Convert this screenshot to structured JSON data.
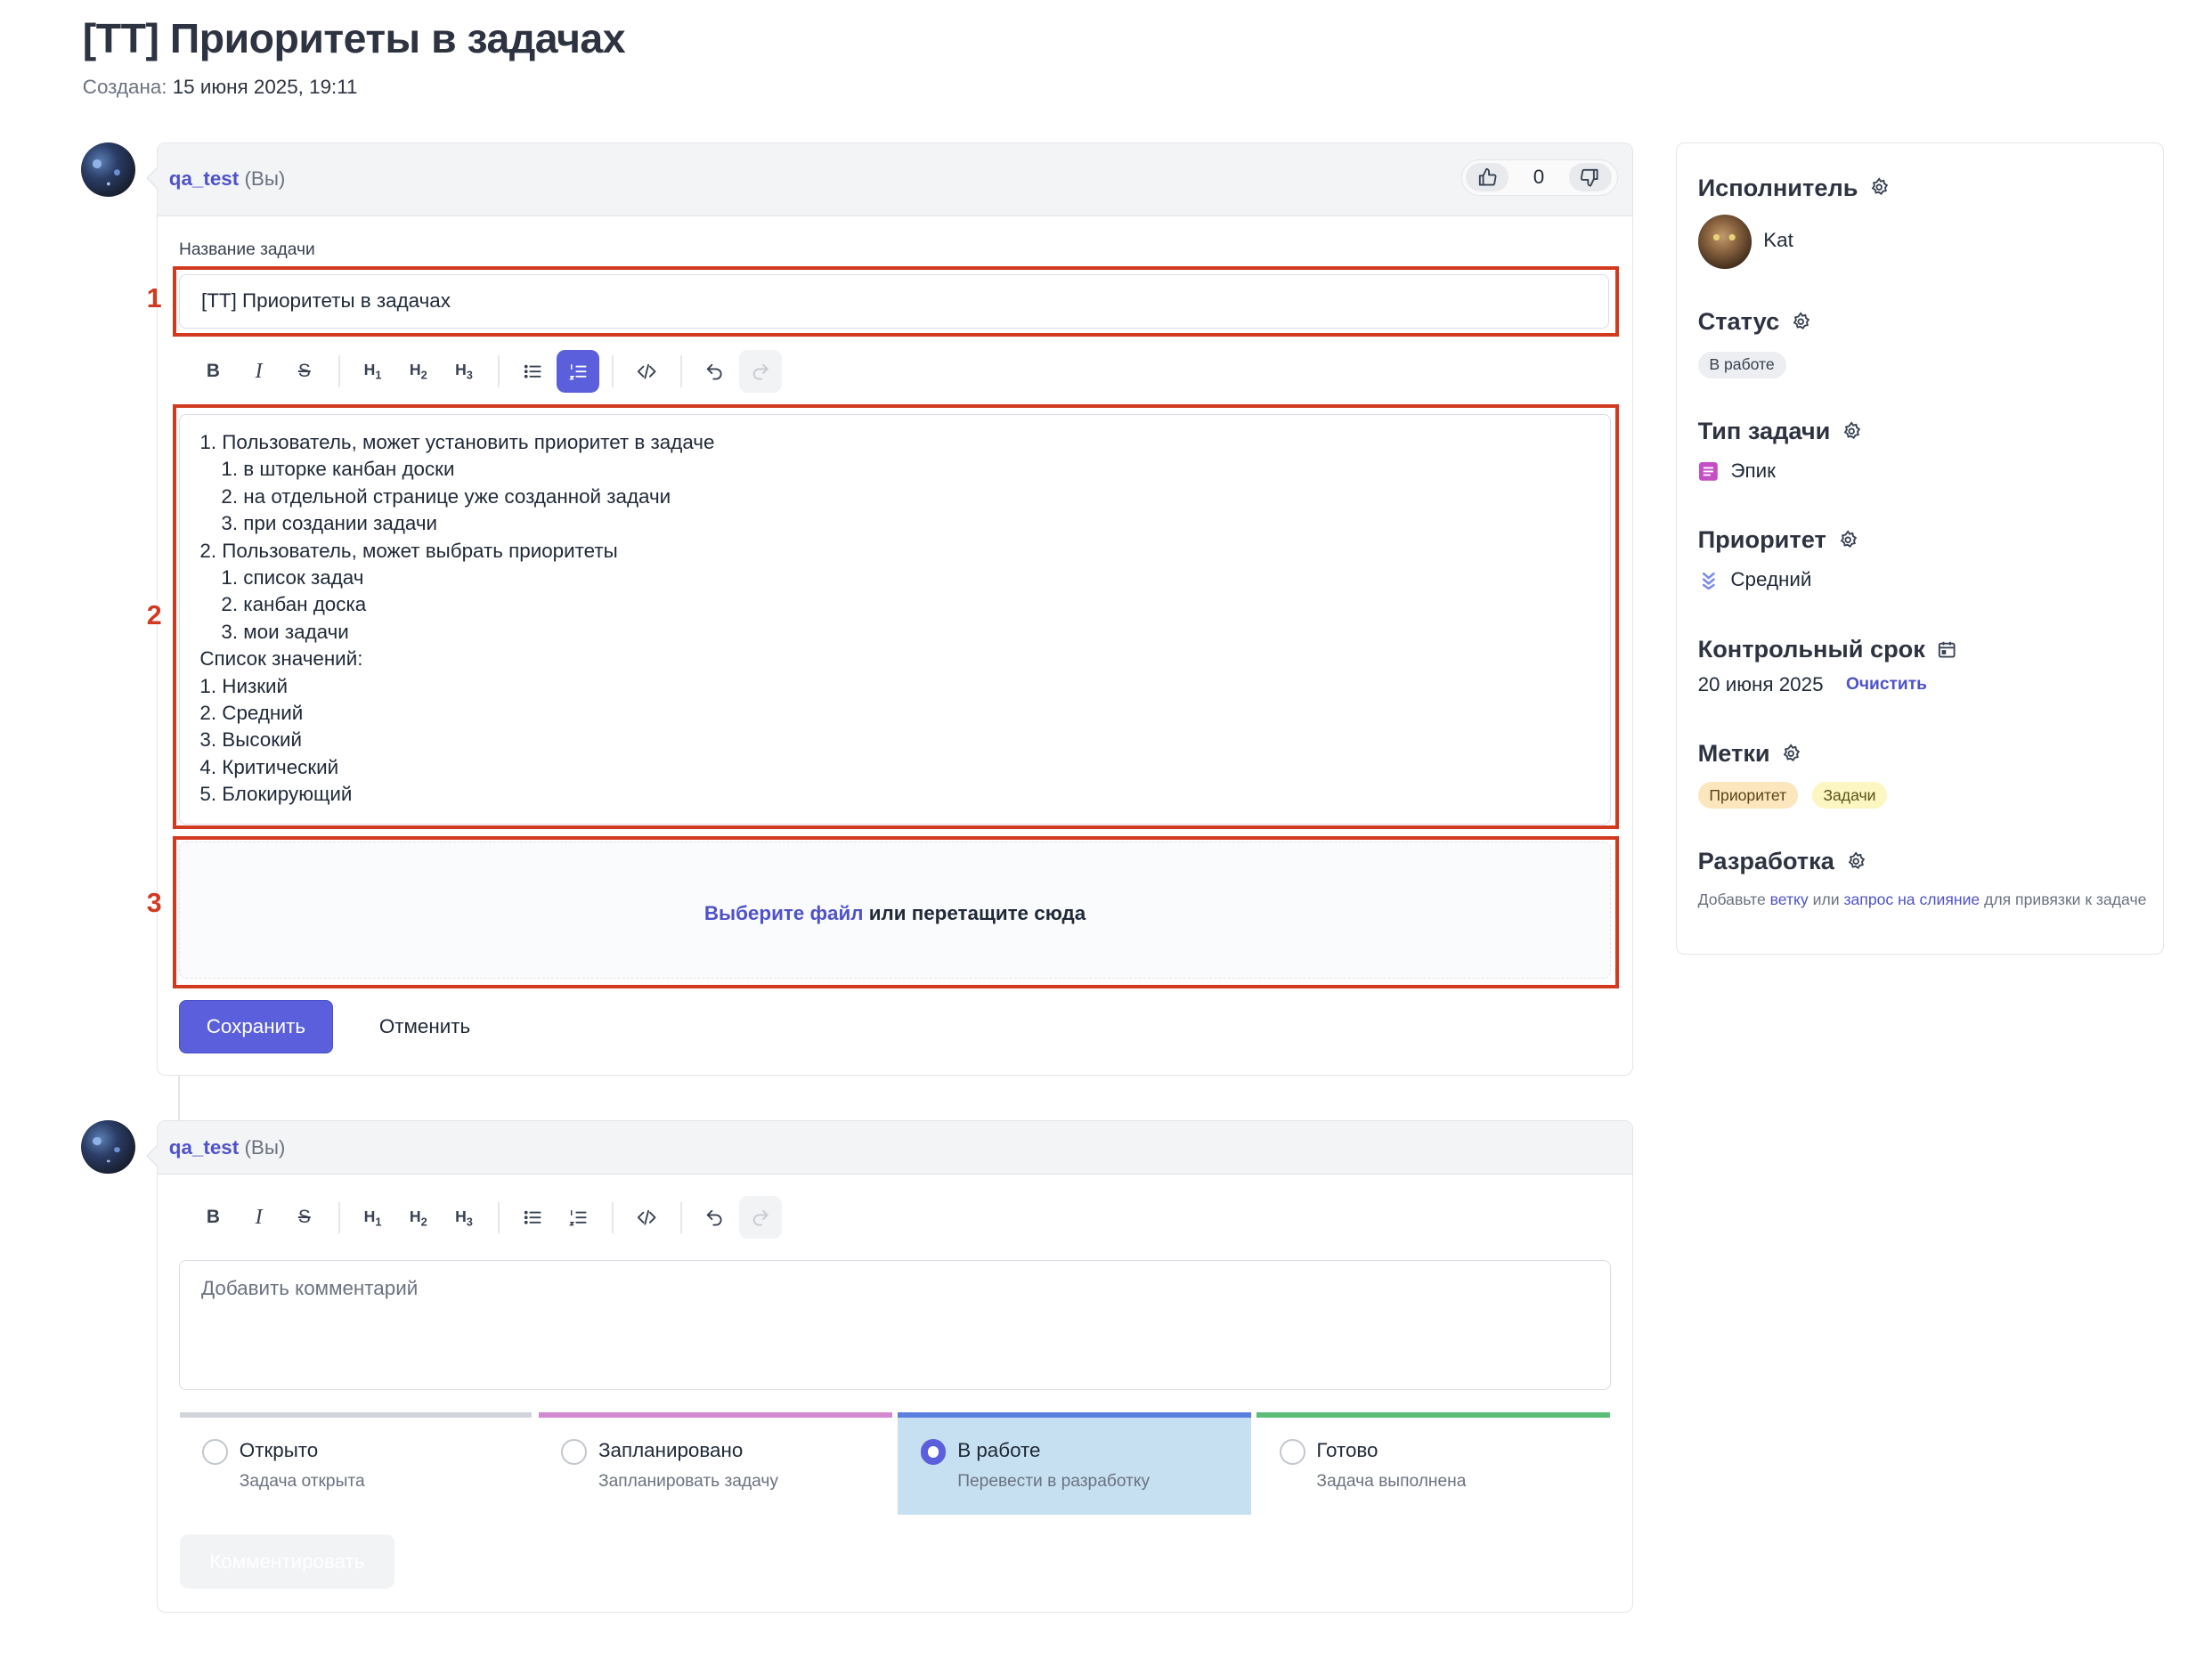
{
  "page": {
    "title": "[TT] Приоритеты в задачах",
    "created_label": "Создана:",
    "created_value": "15 июня 2025, 19:11"
  },
  "edit_card": {
    "user_name": "qa_test",
    "user_suffix": "(Вы)",
    "vote_count": "0",
    "task_name_label": "Название задачи",
    "task_name_value": "[TT] Приоритеты в задачах",
    "description_lines": [
      "1. Пользователь, может установить приоритет в задаче",
      "1. в шторке канбан доски",
      "2. на отдельной странице уже созданной задачи",
      "3. при создании задачи",
      "2. Пользователь, может выбрать приоритеты",
      "1. список задач",
      "2. канбан доска",
      "3. мои задачи",
      "Список значений:",
      "1. Низкий",
      "2. Средний",
      "3. Высокий",
      "4. Критический",
      "5. Блокирующий"
    ],
    "dropzone_link": "Выберите файл",
    "dropzone_text": " или перетащите сюда",
    "save_label": "Сохранить",
    "cancel_label": "Отменить"
  },
  "annotations": [
    "1",
    "2",
    "3"
  ],
  "toolbar": {
    "bold": "B",
    "italic": "I",
    "strike": "S",
    "h1": "H",
    "h2": "H",
    "h3": "H",
    "h1_sub": "1",
    "h2_sub": "2",
    "h3_sub": "3",
    "icons": [
      "bullet-list-icon",
      "ordered-list-icon",
      "code-icon",
      "undo-icon",
      "redo-icon"
    ]
  },
  "comment_card": {
    "user_name": "qa_test",
    "user_suffix": "(Вы)",
    "placeholder": "Добавить комментарий",
    "submit_label": "Комментировать",
    "statuses": [
      {
        "title": "Открыто",
        "desc": "Задача открыта",
        "color": "#d1d5db",
        "selected": false
      },
      {
        "title": "Запланировано",
        "desc": "Запланировать задачу",
        "color": "#d38ad0",
        "selected": false
      },
      {
        "title": "В работе",
        "desc": "Перевести в разработку",
        "color": "#5b7fe0",
        "selected": true
      },
      {
        "title": "Готово",
        "desc": "Задача выполнена",
        "color": "#5cbd7a",
        "selected": false
      }
    ]
  },
  "sidebar": {
    "assignee_label": "Исполнитель",
    "assignee_name": "Kat",
    "status_label": "Статус",
    "status_value": "В работе",
    "type_label": "Тип задачи",
    "type_value": "Эпик",
    "priority_label": "Приоритет",
    "priority_value": "Средний",
    "deadline_label": "Контрольный срок",
    "deadline_value": "20 июня 2025",
    "deadline_clear": "Очистить",
    "labels_label": "Метки",
    "labels": [
      "Приоритет",
      "Задачи"
    ],
    "dev_label": "Разработка",
    "dev_text_1": "Добавьте",
    "dev_link_1": "ветку",
    "dev_text_2": "или",
    "dev_link_2": "запрос на слияние",
    "dev_text_3": "для привязки к задаче"
  },
  "colors": {
    "accent": "#5b5fdb",
    "link": "#4f52c9",
    "highlight": "#d23a20",
    "selected_status_bg": "#c6e0f1",
    "label_priority_bg": "#fbe6bd",
    "label_tasks_bg": "#fbf6c2",
    "epic_icon": "#c44fc4"
  }
}
